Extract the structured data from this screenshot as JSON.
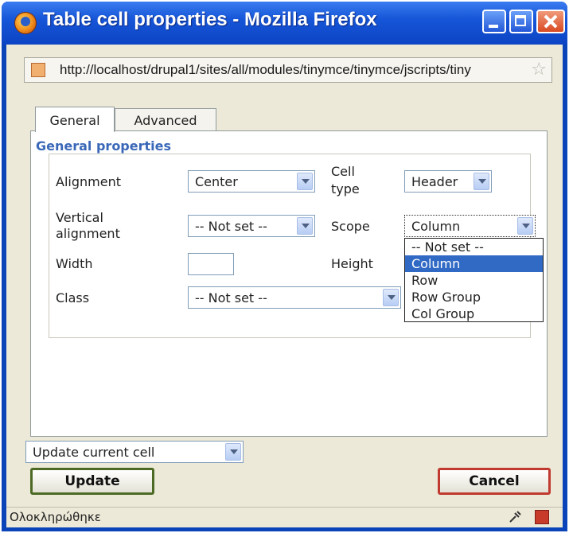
{
  "window": {
    "title": "Table cell properties - Mozilla Firefox"
  },
  "address_bar": {
    "url": "http://localhost/drupal1/sites/all/modules/tinymce/tinymce/jscripts/tiny"
  },
  "tabs": [
    {
      "label": "General",
      "active": true
    },
    {
      "label": "Advanced",
      "active": false
    }
  ],
  "general_properties": {
    "legend": "General properties",
    "alignment": {
      "label": "Alignment",
      "value": "Center"
    },
    "cell_type": {
      "label_line1": "Cell",
      "label_line2": "type",
      "value": "Header"
    },
    "vertical_alignment": {
      "label_line1": "Vertical",
      "label_line2": "alignment",
      "value": "-- Not set --"
    },
    "scope": {
      "label": "Scope",
      "value": "Column",
      "options": [
        "-- Not set --",
        "Column",
        "Row",
        "Row Group",
        "Col Group"
      ],
      "highlighted_index": 1
    },
    "width": {
      "label": "Width",
      "value": ""
    },
    "height": {
      "label": "Height",
      "value": ""
    },
    "class": {
      "label": "Class",
      "value": "-- Not set --"
    }
  },
  "action_select": {
    "value": "Update current cell"
  },
  "buttons": {
    "update": "Update",
    "cancel": "Cancel"
  },
  "status_bar": {
    "text": "Ολοκληρώθηκε"
  },
  "colors": {
    "title_bar": "#1656d8",
    "dialog_bg": "#ece9d8",
    "legend_text": "#3a68b8",
    "selection": "#316ac5",
    "update_border": "#4c6a24",
    "cancel_border": "#c03a30"
  }
}
